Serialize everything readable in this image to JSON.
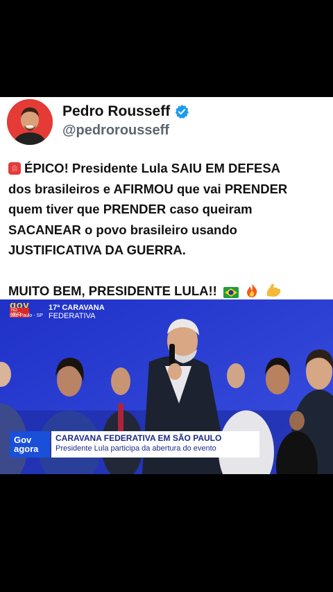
{
  "post": {
    "author_name": "Pedro Rousseff",
    "author_handle": "@pedrorousseff",
    "line1": "ÉPICO! Presidente Lula SAIU EM DEFESA",
    "line2": "dos brasileiros e AFIRMOU que vai PRENDER",
    "line3": "quem tiver que PRENDER caso queiram",
    "line4": "SACANEAR o povo brasileiro usando",
    "line5": "JUSTIFICATIVA DA GUERRA.",
    "line6": "MUITO BEM, PRESIDENTE LULA!!",
    "emojis": [
      "siren-icon",
      "brazil-flag-icon",
      "fire-icon",
      "flexed-biceps-icon"
    ]
  },
  "video": {
    "logo_gov": "gov",
    "logo_live": "NO VIVO",
    "logo_place": "São Paulo - SP",
    "logo_event_line1": "17ª CARAVANA",
    "logo_event_line2": "FEDERATIVA",
    "lower_third": {
      "badge_line1": "Gov",
      "badge_line2": "agora",
      "title": "CARAVANA FEDERATIVA EM SÃO PAULO",
      "subtitle": "Presidente Lula participa da abertura do evento"
    }
  },
  "colors": {
    "avatar_bg": "#e53b36",
    "verified": "#1d9bf0",
    "stage_blue": "#2136c4",
    "lower_third_text": "#1b2a88"
  }
}
